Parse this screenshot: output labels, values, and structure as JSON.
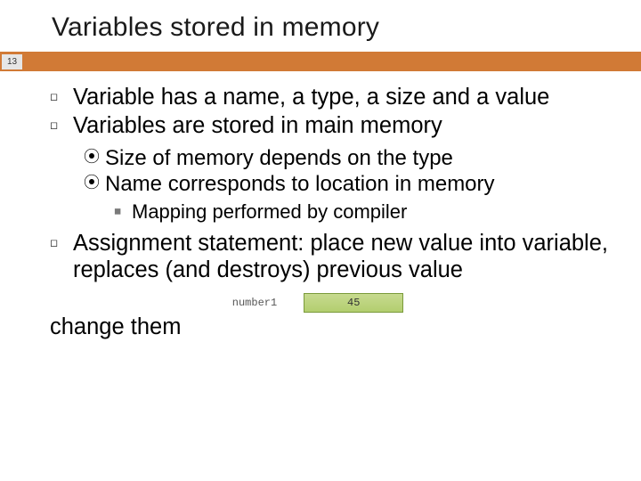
{
  "slide": {
    "title": "Variables stored in memory",
    "page_number": "13",
    "bullets": {
      "b1": "Variable has a name, a type, a size and a value",
      "b2": "Variables are stored in main memory",
      "b2a": "Size of memory depends on the type",
      "b2b": "Name corresponds to location in memory",
      "b2b1": "Mapping performed by compiler",
      "b3": "Assignment statement: place new value into variable, replaces (and destroys) previous value",
      "cutoff": "change them"
    },
    "memory": {
      "label": "number1",
      "value": "45"
    }
  },
  "colors": {
    "accent": "#d17a36",
    "cell_fill": "#b8d178",
    "cell_border": "#7a9a3a"
  }
}
